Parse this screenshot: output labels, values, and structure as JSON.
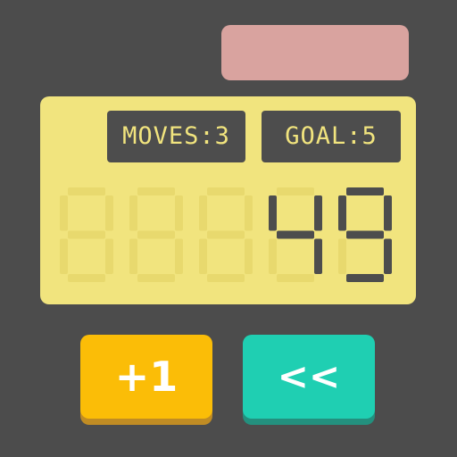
{
  "top_indicator": {
    "color": "#d9a39f"
  },
  "display": {
    "moves_label": "MOVES:3",
    "goal_label": "GOAL:5",
    "total_digits": 5,
    "value": "49",
    "lcd_color": "#f1e47e",
    "digit_on_color": "#4d4d4d",
    "digit_off_color": "#e8d96e"
  },
  "buttons": {
    "plus_one": {
      "label": "+1",
      "color": "#fbbd07"
    },
    "back": {
      "label": "<<",
      "color": "#1fcfb2"
    }
  }
}
